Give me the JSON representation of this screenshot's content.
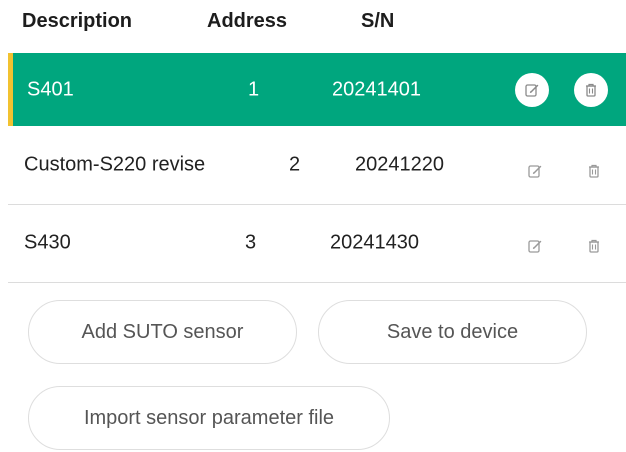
{
  "table": {
    "headers": {
      "description": "Description",
      "address": "Address",
      "sn": "S/N"
    },
    "rows": [
      {
        "description": "S401",
        "address": "1",
        "sn": "20241401",
        "selected": true
      },
      {
        "description": "Custom-S220 revise",
        "address": "2",
        "sn": "20241220",
        "selected": false
      },
      {
        "description": "S430",
        "address": "3",
        "sn": "20241430",
        "selected": false
      }
    ]
  },
  "buttons": {
    "add_sensor": "Add SUTO sensor",
    "save_to_device": "Save to device",
    "import_file": "Import sensor parameter file"
  },
  "icons": {
    "edit": "edit-icon",
    "delete": "trash-icon"
  },
  "colors": {
    "selected_row_bg": "#00a67e",
    "selected_row_marker": "#f2c230",
    "icon_gray": "#9a9a9a"
  }
}
